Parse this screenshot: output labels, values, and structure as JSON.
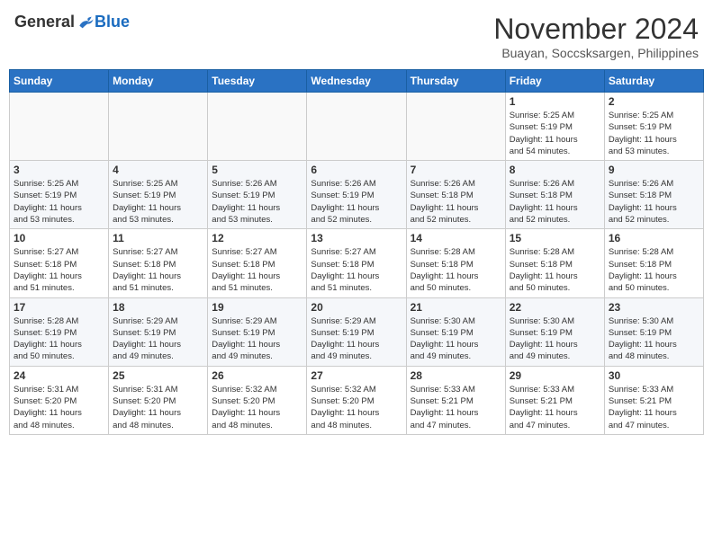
{
  "logo": {
    "general": "General",
    "blue": "Blue"
  },
  "title": "November 2024",
  "location": "Buayan, Soccsksargen, Philippines",
  "days_of_week": [
    "Sunday",
    "Monday",
    "Tuesday",
    "Wednesday",
    "Thursday",
    "Friday",
    "Saturday"
  ],
  "weeks": [
    [
      {
        "day": "",
        "info": ""
      },
      {
        "day": "",
        "info": ""
      },
      {
        "day": "",
        "info": ""
      },
      {
        "day": "",
        "info": ""
      },
      {
        "day": "",
        "info": ""
      },
      {
        "day": "1",
        "info": "Sunrise: 5:25 AM\nSunset: 5:19 PM\nDaylight: 11 hours\nand 54 minutes."
      },
      {
        "day": "2",
        "info": "Sunrise: 5:25 AM\nSunset: 5:19 PM\nDaylight: 11 hours\nand 53 minutes."
      }
    ],
    [
      {
        "day": "3",
        "info": "Sunrise: 5:25 AM\nSunset: 5:19 PM\nDaylight: 11 hours\nand 53 minutes."
      },
      {
        "day": "4",
        "info": "Sunrise: 5:25 AM\nSunset: 5:19 PM\nDaylight: 11 hours\nand 53 minutes."
      },
      {
        "day": "5",
        "info": "Sunrise: 5:26 AM\nSunset: 5:19 PM\nDaylight: 11 hours\nand 53 minutes."
      },
      {
        "day": "6",
        "info": "Sunrise: 5:26 AM\nSunset: 5:19 PM\nDaylight: 11 hours\nand 52 minutes."
      },
      {
        "day": "7",
        "info": "Sunrise: 5:26 AM\nSunset: 5:18 PM\nDaylight: 11 hours\nand 52 minutes."
      },
      {
        "day": "8",
        "info": "Sunrise: 5:26 AM\nSunset: 5:18 PM\nDaylight: 11 hours\nand 52 minutes."
      },
      {
        "day": "9",
        "info": "Sunrise: 5:26 AM\nSunset: 5:18 PM\nDaylight: 11 hours\nand 52 minutes."
      }
    ],
    [
      {
        "day": "10",
        "info": "Sunrise: 5:27 AM\nSunset: 5:18 PM\nDaylight: 11 hours\nand 51 minutes."
      },
      {
        "day": "11",
        "info": "Sunrise: 5:27 AM\nSunset: 5:18 PM\nDaylight: 11 hours\nand 51 minutes."
      },
      {
        "day": "12",
        "info": "Sunrise: 5:27 AM\nSunset: 5:18 PM\nDaylight: 11 hours\nand 51 minutes."
      },
      {
        "day": "13",
        "info": "Sunrise: 5:27 AM\nSunset: 5:18 PM\nDaylight: 11 hours\nand 51 minutes."
      },
      {
        "day": "14",
        "info": "Sunrise: 5:28 AM\nSunset: 5:18 PM\nDaylight: 11 hours\nand 50 minutes."
      },
      {
        "day": "15",
        "info": "Sunrise: 5:28 AM\nSunset: 5:18 PM\nDaylight: 11 hours\nand 50 minutes."
      },
      {
        "day": "16",
        "info": "Sunrise: 5:28 AM\nSunset: 5:18 PM\nDaylight: 11 hours\nand 50 minutes."
      }
    ],
    [
      {
        "day": "17",
        "info": "Sunrise: 5:28 AM\nSunset: 5:19 PM\nDaylight: 11 hours\nand 50 minutes."
      },
      {
        "day": "18",
        "info": "Sunrise: 5:29 AM\nSunset: 5:19 PM\nDaylight: 11 hours\nand 49 minutes."
      },
      {
        "day": "19",
        "info": "Sunrise: 5:29 AM\nSunset: 5:19 PM\nDaylight: 11 hours\nand 49 minutes."
      },
      {
        "day": "20",
        "info": "Sunrise: 5:29 AM\nSunset: 5:19 PM\nDaylight: 11 hours\nand 49 minutes."
      },
      {
        "day": "21",
        "info": "Sunrise: 5:30 AM\nSunset: 5:19 PM\nDaylight: 11 hours\nand 49 minutes."
      },
      {
        "day": "22",
        "info": "Sunrise: 5:30 AM\nSunset: 5:19 PM\nDaylight: 11 hours\nand 49 minutes."
      },
      {
        "day": "23",
        "info": "Sunrise: 5:30 AM\nSunset: 5:19 PM\nDaylight: 11 hours\nand 48 minutes."
      }
    ],
    [
      {
        "day": "24",
        "info": "Sunrise: 5:31 AM\nSunset: 5:20 PM\nDaylight: 11 hours\nand 48 minutes."
      },
      {
        "day": "25",
        "info": "Sunrise: 5:31 AM\nSunset: 5:20 PM\nDaylight: 11 hours\nand 48 minutes."
      },
      {
        "day": "26",
        "info": "Sunrise: 5:32 AM\nSunset: 5:20 PM\nDaylight: 11 hours\nand 48 minutes."
      },
      {
        "day": "27",
        "info": "Sunrise: 5:32 AM\nSunset: 5:20 PM\nDaylight: 11 hours\nand 48 minutes."
      },
      {
        "day": "28",
        "info": "Sunrise: 5:33 AM\nSunset: 5:21 PM\nDaylight: 11 hours\nand 47 minutes."
      },
      {
        "day": "29",
        "info": "Sunrise: 5:33 AM\nSunset: 5:21 PM\nDaylight: 11 hours\nand 47 minutes."
      },
      {
        "day": "30",
        "info": "Sunrise: 5:33 AM\nSunset: 5:21 PM\nDaylight: 11 hours\nand 47 minutes."
      }
    ]
  ]
}
